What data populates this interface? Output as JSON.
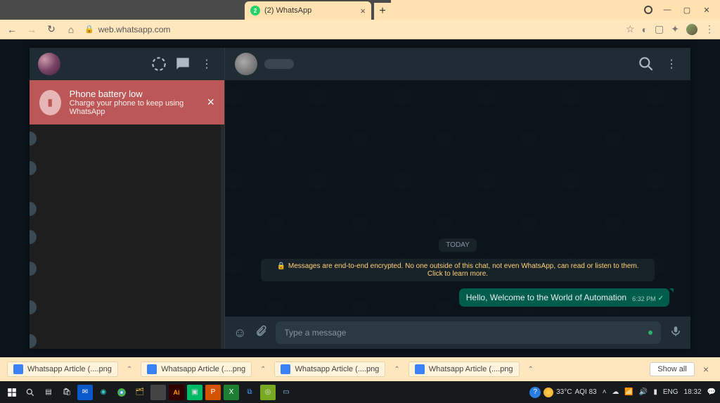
{
  "browser": {
    "tab_title": "(2) WhatsApp",
    "url": "web.whatsapp.com"
  },
  "side": {
    "banner": {
      "title": "Phone battery low",
      "subtitle": "Charge your phone to keep using WhatsApp"
    }
  },
  "conv": {
    "date_chip": "TODAY",
    "encryption_notice": "Messages are end-to-end encrypted. No one outside of this chat, not even WhatsApp, can read or listen to them. Click to learn more.",
    "message_text": "Hello, Welcome to the World of Automation",
    "message_time": "6:32 PM",
    "input_placeholder": "Type a message"
  },
  "downloads": {
    "items": [
      {
        "name": "Whatsapp Article (....png"
      },
      {
        "name": "Whatsapp Article (....png"
      },
      {
        "name": "Whatsapp Article (....png"
      },
      {
        "name": "Whatsapp Article (....png"
      }
    ],
    "show_all": "Show all"
  },
  "taskbar": {
    "weather_temp": "33°C",
    "aqi": "AQI 83",
    "lang": "ENG",
    "time": "18:32"
  }
}
